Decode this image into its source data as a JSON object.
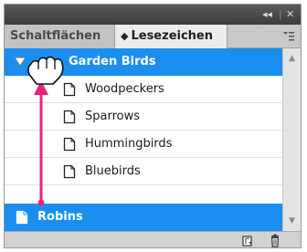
{
  "window": {
    "collapse_icon": "double-chevron-left-icon",
    "close_icon": "close-icon"
  },
  "tabs": [
    {
      "label": "Schaltflächen",
      "active": false
    },
    {
      "label": "Lesezeichen",
      "active": true
    }
  ],
  "panel_menu_icon": "panel-menu-icon",
  "bookmarks": {
    "parent": {
      "label": "Garden Birds",
      "expanded": true,
      "selected": true
    },
    "children": [
      {
        "label": "Woodpeckers"
      },
      {
        "label": "Sparrows"
      },
      {
        "label": "Hummingbirds"
      },
      {
        "label": "Bluebirds"
      }
    ],
    "dragged": {
      "label": "Robins",
      "selected": true
    }
  },
  "drag_indicator": {
    "cursor": "grab-hand-cursor-icon",
    "arrow": "up-arrow-icon",
    "color": "#e8237a"
  },
  "bottom_bar": {
    "new_bookmark_icon": "new-bookmark-icon",
    "delete_icon": "trash-icon"
  },
  "colors": {
    "selection": "#1a8ef0",
    "titlebar": "#444444"
  }
}
